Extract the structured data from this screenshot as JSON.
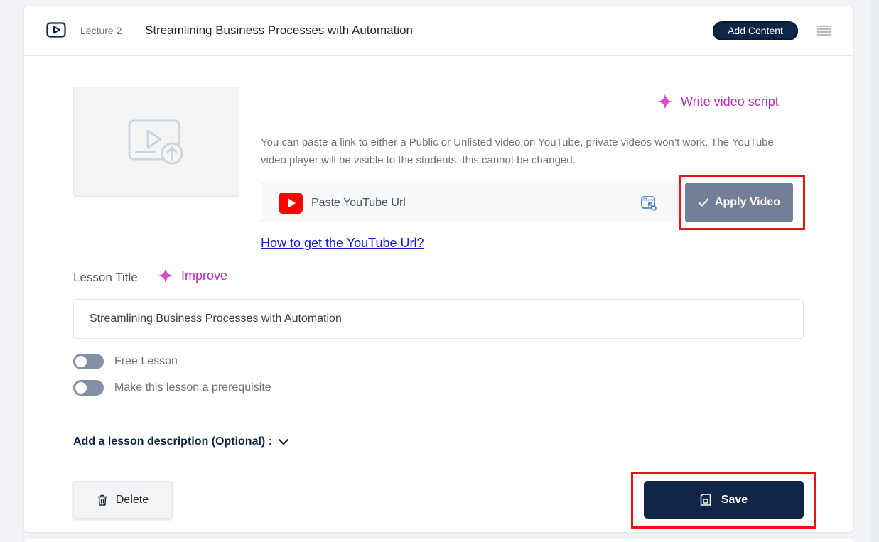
{
  "lecture": {
    "number_label": "Lecture 2",
    "title": "Streamlining Business Processes with Automation",
    "add_content_label": "Add Content"
  },
  "video": {
    "write_script_label": "Write video script",
    "help_text": "You can paste a link to either a Public or Unlisted video on YouTube, private videos won’t work. The YouTube video player will be visible to the students, this cannot be changed.",
    "url_placeholder": "Paste YouTube Url",
    "url_value": "",
    "apply_label": "Apply Video",
    "how_to_link": "How to get the YouTube Url?"
  },
  "lesson": {
    "title_label": "Lesson Title",
    "improve_label": "Improve",
    "title_value": "Streamlining Business Processes with Automation"
  },
  "toggles": [
    {
      "label": "Free Lesson",
      "on": false
    },
    {
      "label": "Make this lesson a prerequisite",
      "on": false
    }
  ],
  "description_label": "Add a lesson description (Optional) :",
  "actions": {
    "delete_label": "Delete",
    "save_label": "Save"
  },
  "colors": {
    "primary": "#0f2547",
    "accent_ai": "#b02fb9",
    "apply_bg": "#737f96",
    "highlight": "#ee1313",
    "youtube_red": "#ff0000",
    "link": "#1a1ad6"
  },
  "icons": {
    "lecture": "video-play-icon",
    "menu": "drag-handle-icon",
    "ai": "sparkle-icon",
    "youtube": "youtube-icon",
    "paste": "paste-link-icon",
    "apply": "check-icon",
    "chevron": "chevron-down-icon",
    "delete": "trash-icon",
    "save": "save-icon",
    "thumbnail": "video-upload-icon"
  }
}
